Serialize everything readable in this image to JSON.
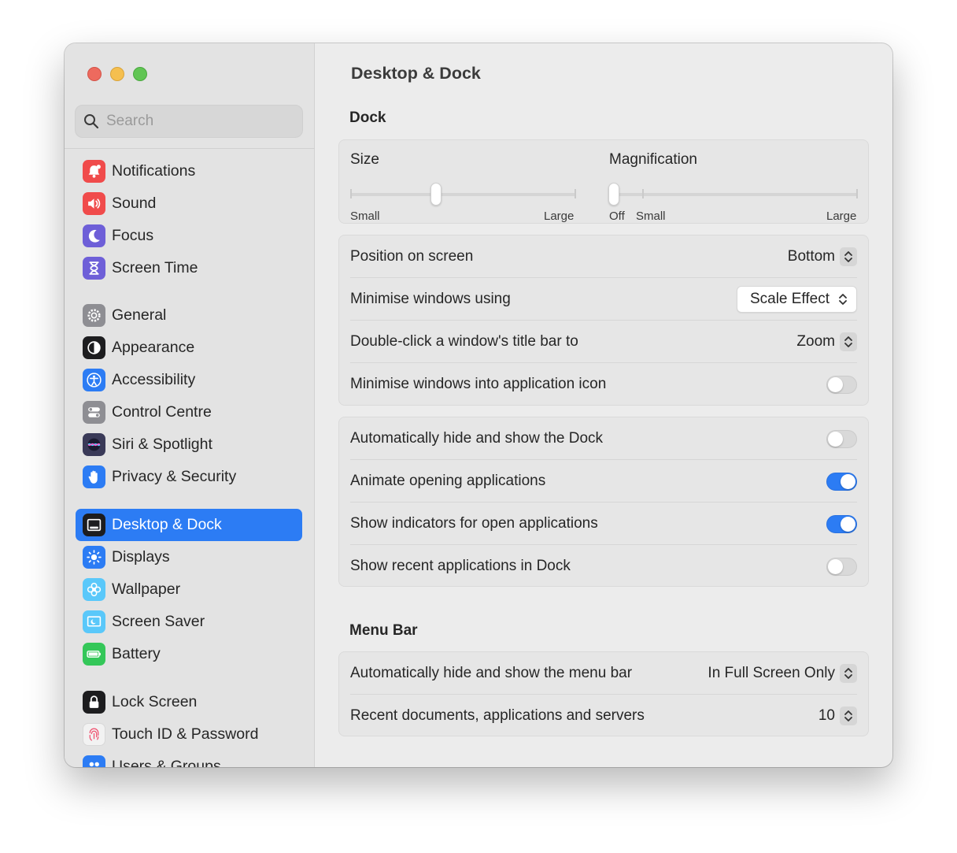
{
  "sidebar": {
    "search_placeholder": "Search",
    "items": [
      {
        "label": "Notifications",
        "icon": "bell-icon",
        "color": "#f04b4b"
      },
      {
        "label": "Sound",
        "icon": "speaker-icon",
        "color": "#f04b4b"
      },
      {
        "label": "Focus",
        "icon": "moon-icon",
        "color": "#6e5fd8"
      },
      {
        "label": "Screen Time",
        "icon": "hourglass-icon",
        "color": "#6e5fd8"
      },
      {
        "label": "General",
        "icon": "gear-icon",
        "color": "#8e8e93"
      },
      {
        "label": "Appearance",
        "icon": "appearance-icon",
        "color": "#1d1d1f"
      },
      {
        "label": "Accessibility",
        "icon": "accessibility-icon",
        "color": "#2c7cf4"
      },
      {
        "label": "Control Centre",
        "icon": "control-centre-icon",
        "color": "#8e8e93"
      },
      {
        "label": "Siri & Spotlight",
        "icon": "siri-icon",
        "color": "#3a3a58"
      },
      {
        "label": "Privacy & Security",
        "icon": "hand-icon",
        "color": "#2c7cf4"
      },
      {
        "label": "Desktop & Dock",
        "icon": "dock-icon",
        "color": "#1d1d1f"
      },
      {
        "label": "Displays",
        "icon": "sun-icon",
        "color": "#2c7cf4"
      },
      {
        "label": "Wallpaper",
        "icon": "flower-icon",
        "color": "#5ac8fa"
      },
      {
        "label": "Screen Saver",
        "icon": "screen-saver-icon",
        "color": "#5ac8fa"
      },
      {
        "label": "Battery",
        "icon": "battery-icon",
        "color": "#34c759"
      },
      {
        "label": "Lock Screen",
        "icon": "lock-icon",
        "color": "#1d1d1f"
      },
      {
        "label": "Touch ID & Password",
        "icon": "fingerprint-icon",
        "color": "#f2f2f2"
      },
      {
        "label": "Users & Groups",
        "icon": "users-icon",
        "color": "#2c7cf4"
      }
    ],
    "selected": "Desktop & Dock"
  },
  "main": {
    "title": "Desktop & Dock",
    "dock_section": "Dock",
    "size": {
      "label": "Size",
      "min_label": "Small",
      "max_label": "Large",
      "value_fraction": 0.38
    },
    "magnification": {
      "label": "Magnification",
      "off_label": "Off",
      "min_label": "Small",
      "max_label": "Large",
      "value": "Off"
    },
    "rows1": [
      {
        "label": "Position on screen",
        "value": "Bottom"
      },
      {
        "label": "Minimise windows using",
        "value": "Scale Effect"
      },
      {
        "label": "Double-click a window's title bar to",
        "value": "Zoom"
      },
      {
        "label": "Minimise windows into application icon",
        "toggle": false
      }
    ],
    "rows2": [
      {
        "label": "Automatically hide and show the Dock",
        "toggle": false
      },
      {
        "label": "Animate opening applications",
        "toggle": true
      },
      {
        "label": "Show indicators for open applications",
        "toggle": true
      },
      {
        "label": "Show recent applications in Dock",
        "toggle": false
      }
    ],
    "menubar_section": "Menu Bar",
    "rows3": [
      {
        "label": "Automatically hide and show the menu bar",
        "value": "In Full Screen Only"
      },
      {
        "label": "Recent documents, applications and servers",
        "value": "10"
      }
    ]
  },
  "colors": {
    "accent": "#2c7cf4"
  }
}
